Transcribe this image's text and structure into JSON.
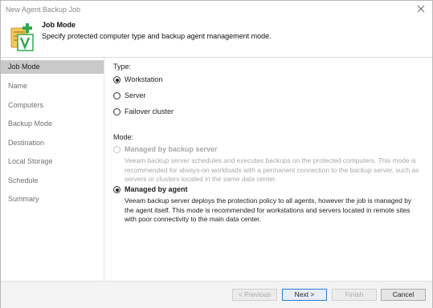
{
  "window": {
    "title": "New Agent Backup Job"
  },
  "header": {
    "title": "Job Mode",
    "subtitle": "Specify protected computer type and backup agent management mode."
  },
  "sidebar": {
    "items": [
      {
        "label": "Job Mode",
        "active": true
      },
      {
        "label": "Name"
      },
      {
        "label": "Computers"
      },
      {
        "label": "Backup Mode"
      },
      {
        "label": "Destination"
      },
      {
        "label": "Local Storage"
      },
      {
        "label": "Schedule"
      },
      {
        "label": "Summary"
      }
    ]
  },
  "type_section": {
    "label": "Type:",
    "options": [
      {
        "label": "Workstation",
        "checked": true
      },
      {
        "label": "Server",
        "checked": false
      },
      {
        "label": "Failover cluster",
        "checked": false
      }
    ]
  },
  "mode_section": {
    "label": "Mode:",
    "by_server": {
      "label": "Managed by backup server",
      "description": "Veeam backup server schedules and executes backups on the protected computers. This mode is recommended for always-on workloads with a permanent connection to the backup server, such as servers or clusters located in the same data center."
    },
    "by_agent": {
      "label": "Managed by agent",
      "description": "Veeam backup server deploys the protection policy to all agents, however the job is managed by the agent itself. This mode is recommended for workstations and servers located in remote sites with poor connectivity to the main data center."
    }
  },
  "footer": {
    "previous": "< Previous",
    "next": "Next >",
    "finish": "Finish",
    "cancel": "Cancel"
  },
  "colors": {
    "active_step_bg": "#c9c9c9",
    "primary_button_border": "#2a7bd3",
    "logo_green": "#2fa84f"
  }
}
